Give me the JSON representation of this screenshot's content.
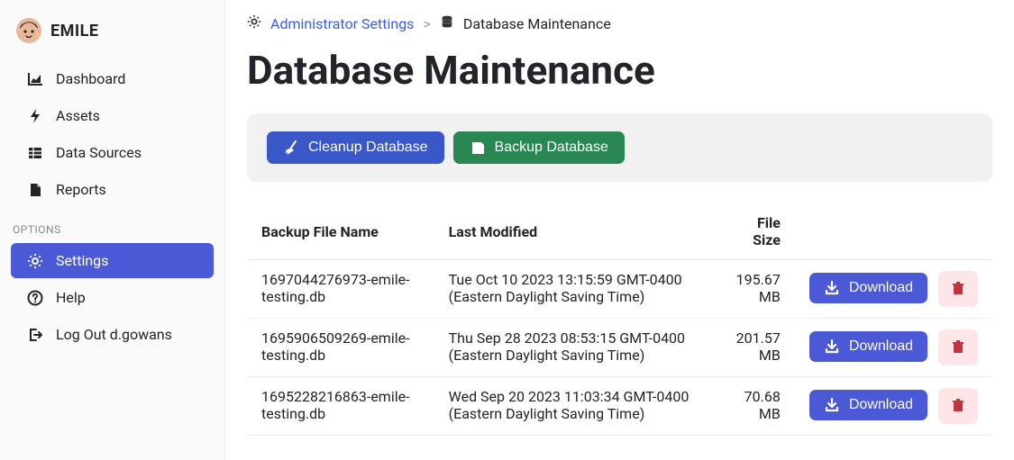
{
  "brand": {
    "name": "EMILE"
  },
  "sidebar": {
    "items": [
      {
        "label": "Dashboard",
        "icon": "chart-area-icon"
      },
      {
        "label": "Assets",
        "icon": "bolt-icon"
      },
      {
        "label": "Data Sources",
        "icon": "table-icon"
      },
      {
        "label": "Reports",
        "icon": "file-icon"
      }
    ],
    "optionsLabel": "OPTIONS",
    "options": [
      {
        "label": "Settings",
        "icon": "gear-icon",
        "active": true
      },
      {
        "label": "Help",
        "icon": "help-icon"
      },
      {
        "label": "Log Out d.gowans",
        "icon": "logout-icon"
      }
    ]
  },
  "breadcrumb": {
    "rootIcon": "gear-icon",
    "rootLabel": "Administrator Settings",
    "sep": ">",
    "leafIcon": "database-icon",
    "leafLabel": "Database Maintenance"
  },
  "pageTitle": "Database Maintenance",
  "actions": {
    "cleanup": "Cleanup Database",
    "backup": "Backup Database"
  },
  "table": {
    "columns": {
      "name": "Backup File Name",
      "modified": "Last Modified",
      "size": "File Size"
    },
    "downloadLabel": "Download",
    "rows": [
      {
        "name": "1697044276973-emile-testing.db",
        "modified": "Tue Oct 10 2023 13:15:59 GMT-0400 (Eastern Daylight Saving Time)",
        "size": "195.67 MB"
      },
      {
        "name": "1695906509269-emile-testing.db",
        "modified": "Thu Sep 28 2023 08:53:15 GMT-0400 (Eastern Daylight Saving Time)",
        "size": "201.57 MB"
      },
      {
        "name": "1695228216863-emile-testing.db",
        "modified": "Wed Sep 20 2023 11:03:34 GMT-0400 (Eastern Daylight Saving Time)",
        "size": "70.68 MB"
      }
    ]
  }
}
